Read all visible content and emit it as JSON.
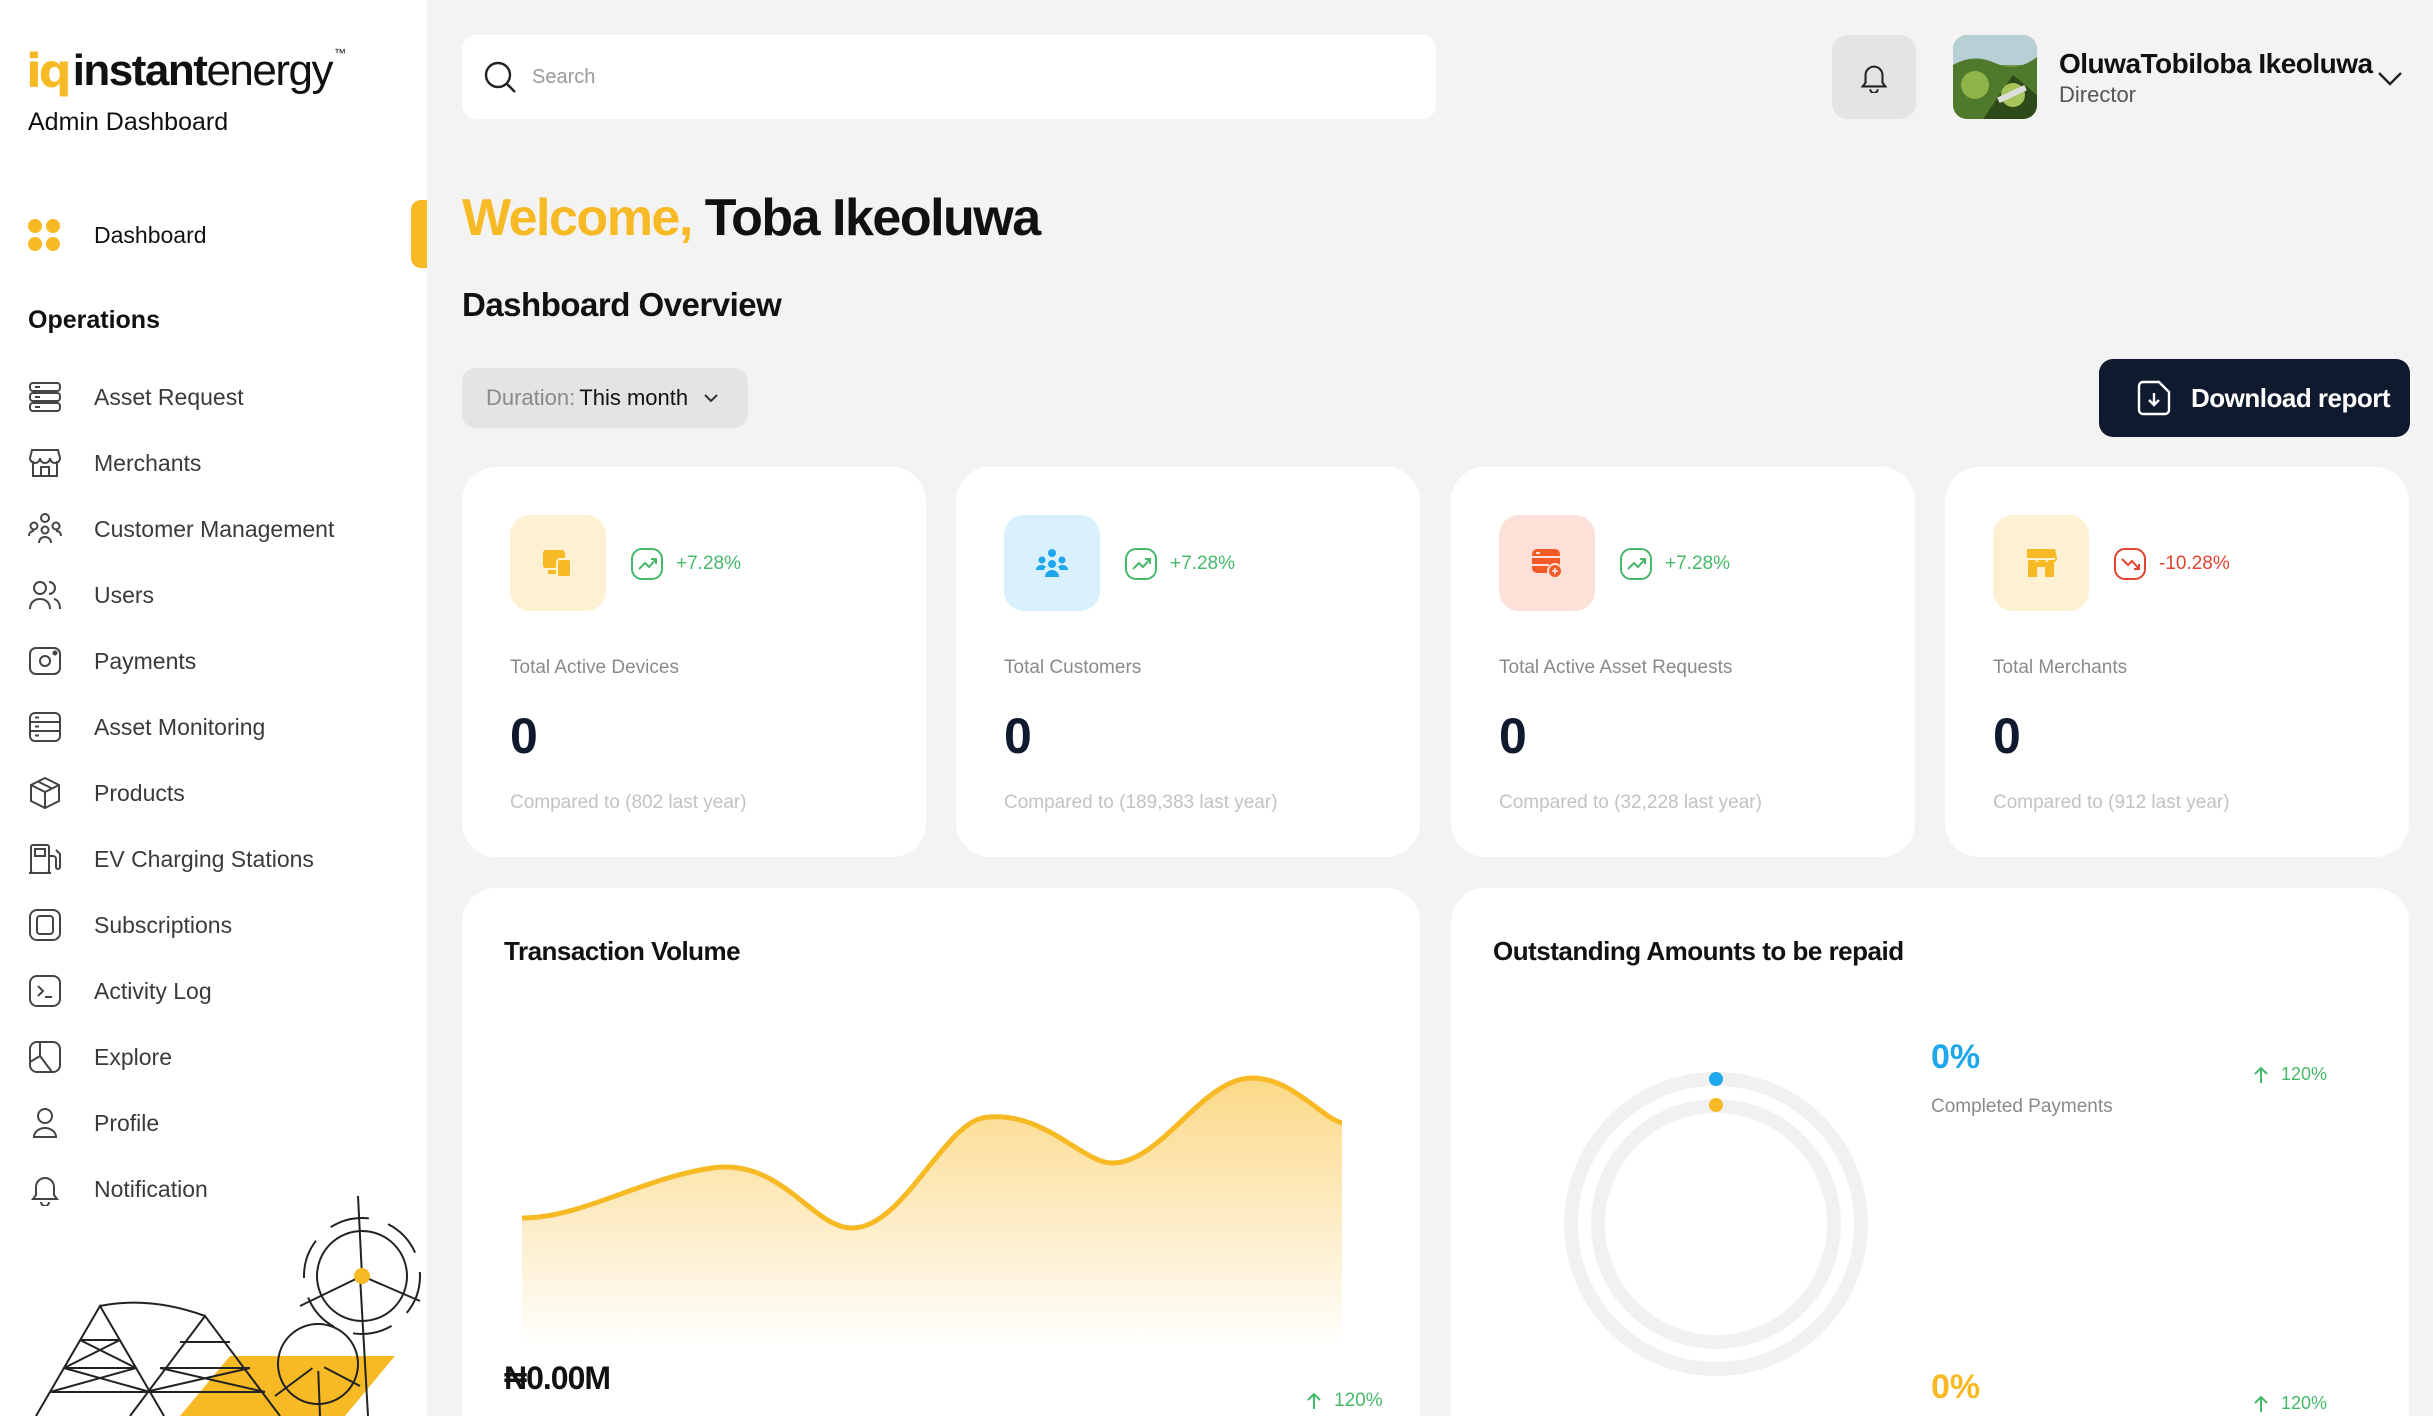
{
  "brand": {
    "logo_mark": "iq",
    "logo_bold": "instant",
    "logo_light": "energy",
    "logo_tm": "™",
    "subtitle": "Admin Dashboard"
  },
  "sidebar": {
    "active_item": "Dashboard",
    "section_title": "Operations",
    "items": [
      {
        "label": "Asset Request",
        "icon": "server-icon"
      },
      {
        "label": "Merchants",
        "icon": "store-icon"
      },
      {
        "label": "Customer Management",
        "icon": "people-group-icon"
      },
      {
        "label": "Users",
        "icon": "users-icon"
      },
      {
        "label": "Payments",
        "icon": "payment-icon"
      },
      {
        "label": "Asset Monitoring",
        "icon": "monitor-icon"
      },
      {
        "label": "Products",
        "icon": "box-icon"
      },
      {
        "label": "EV Charging Stations",
        "icon": "ev-station-icon"
      },
      {
        "label": "Subscriptions",
        "icon": "subscription-icon"
      },
      {
        "label": "Activity Log",
        "icon": "terminal-icon"
      },
      {
        "label": "Explore",
        "icon": "map-icon"
      },
      {
        "label": "Profile",
        "icon": "profile-icon"
      },
      {
        "label": "Notification",
        "icon": "bell-icon"
      }
    ]
  },
  "search": {
    "placeholder": "Search"
  },
  "user": {
    "name": "OluwaTobiloba Ikeoluwa",
    "role": "Director"
  },
  "welcome": {
    "prefix": "Welcome,",
    "name": "Toba Ikeoluwa"
  },
  "overview_title": "Dashboard Overview",
  "duration": {
    "label": "Duration:",
    "value": "This month"
  },
  "download_label": "Download report",
  "stats": [
    {
      "label": "Total Active Devices",
      "value": "0",
      "trend": "+7.28%",
      "compare": "Compared to (802 last year)",
      "accent": "#f7b924",
      "bg": "#fdf0d3",
      "direction": "up"
    },
    {
      "label": "Total Customers",
      "value": "0",
      "trend": "+7.28%",
      "compare": "Compared to (189,383 last year)",
      "accent": "#1ea7ec",
      "bg": "#d9f1fc",
      "direction": "up"
    },
    {
      "label": "Total Active Asset Requests",
      "value": "0",
      "trend": "+7.28%",
      "compare": "Compared to (32,228 last year)",
      "accent": "#f25a2a",
      "bg": "#fde0d7",
      "direction": "up"
    },
    {
      "label": "Total Merchants",
      "value": "0",
      "trend": "-10.28%",
      "compare": "Compared to (912 last year)",
      "accent": "#f7b924",
      "bg": "#fdf0d3",
      "direction": "down"
    }
  ],
  "colors": {
    "up": "#45b86a",
    "down": "#e0432f",
    "accent": "#f7b924",
    "navy": "#0f1a2e"
  },
  "transaction": {
    "title": "Transaction Volume",
    "amount": "₦0.00M",
    "change": "120%"
  },
  "outstanding": {
    "title": "Outstanding Amounts to be repaid",
    "rows": [
      {
        "pct": "0%",
        "label": "Completed Payments",
        "change": "120%",
        "color": "#1ea7ec"
      },
      {
        "pct": "0%",
        "label": "",
        "change": "120%",
        "color": "#f7b924"
      }
    ]
  }
}
